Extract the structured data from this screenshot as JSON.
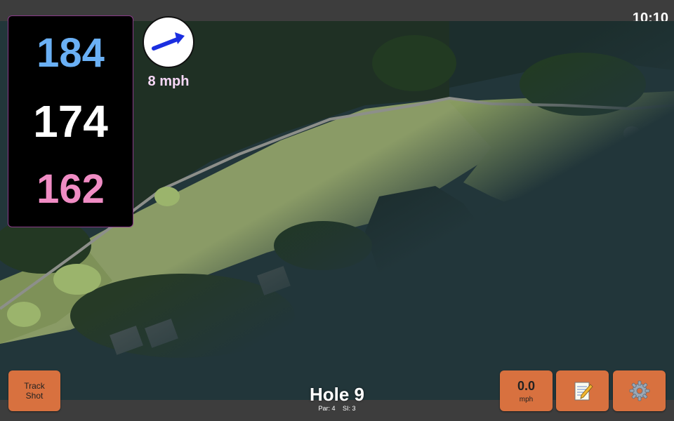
{
  "status": {
    "time": "10:10"
  },
  "distances": {
    "back": "184",
    "middle": "174",
    "front": "162"
  },
  "wind": {
    "speed": "8 mph",
    "icon": "wind-direction-arrow-icon"
  },
  "hole": {
    "title": "Hole 9",
    "par": "Par: 4",
    "si": "SI: 3"
  },
  "buttons": {
    "track_shot": [
      "Track",
      "Shot"
    ],
    "speed": {
      "value": "0.0",
      "unit": "mph"
    },
    "notes_icon": "notepad-icon",
    "settings_icon": "gear-icon"
  },
  "colors": {
    "back_distance": "#6ab0f5",
    "middle_distance": "#ffffff",
    "front_distance": "#f08cc4",
    "wind_speed": "#f7d8f7",
    "wind_arrow": "#1a2ee0",
    "button": "#d8713f",
    "panel_border": "#8a3a8a"
  }
}
